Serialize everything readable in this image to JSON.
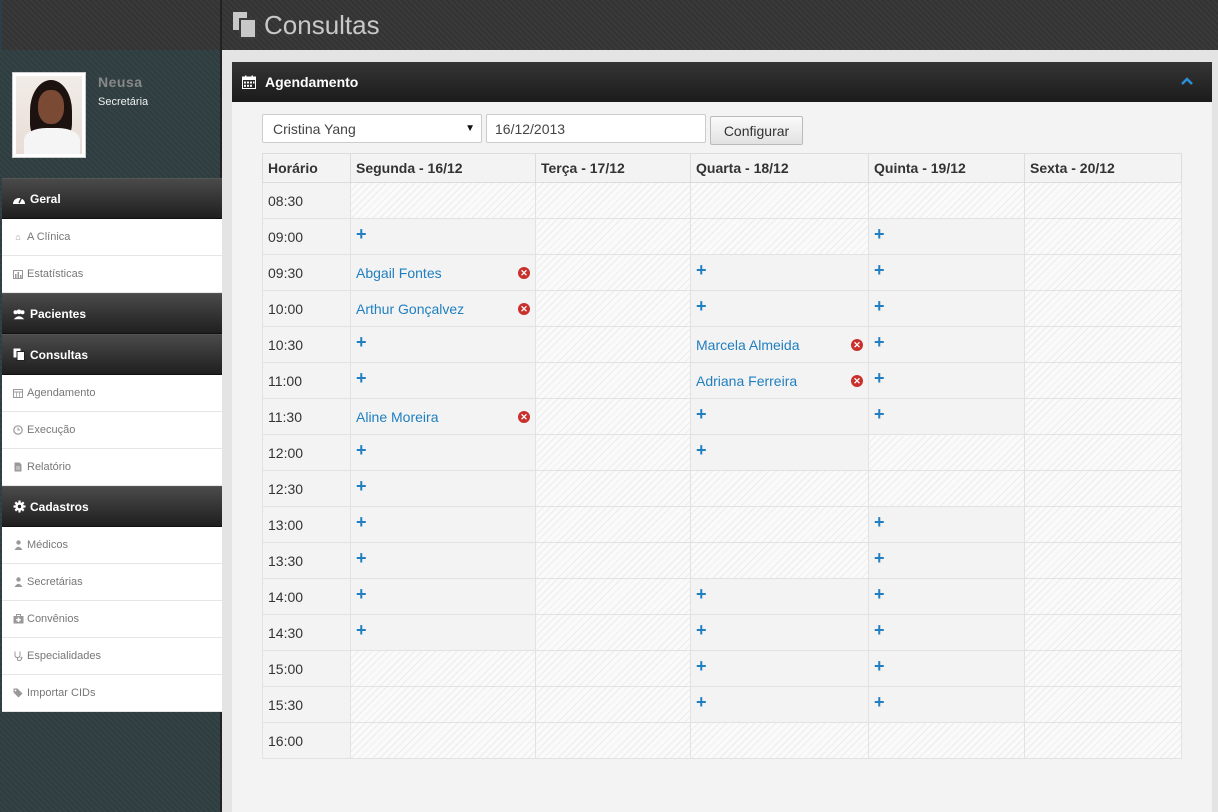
{
  "header": {
    "title": "Consultas"
  },
  "user": {
    "name": "Neusa",
    "role": "Secretária"
  },
  "sidebar": {
    "sections": [
      {
        "label": "Geral",
        "icon": "dashboard-icon",
        "items": [
          {
            "label": "A Clínica",
            "icon": "home-icon"
          },
          {
            "label": "Estatísticas",
            "icon": "bar-chart-icon"
          }
        ]
      },
      {
        "label": "Pacientes",
        "icon": "users-icon",
        "items": []
      },
      {
        "label": "Consultas",
        "icon": "copy-icon",
        "items": [
          {
            "label": "Agendamento",
            "icon": "calendar-icon"
          },
          {
            "label": "Execução",
            "icon": "clock-icon"
          },
          {
            "label": "Relatório",
            "icon": "file-icon"
          }
        ]
      },
      {
        "label": "Cadastros",
        "icon": "gear-icon",
        "items": [
          {
            "label": "Médicos",
            "icon": "user-md-icon"
          },
          {
            "label": "Secretárias",
            "icon": "user-icon"
          },
          {
            "label": "Convênios",
            "icon": "medkit-icon"
          },
          {
            "label": "Especialidades",
            "icon": "stethoscope-icon"
          },
          {
            "label": "Importar CIDs",
            "icon": "tags-icon"
          }
        ]
      }
    ]
  },
  "panel": {
    "title": "Agendamento",
    "doctor_select": "Cristina Yang",
    "date_value": "16/12/2013",
    "configure_label": "Configurar"
  },
  "schedule": {
    "time_header": "Horário",
    "days": [
      "Segunda - 16/12",
      "Terça - 17/12",
      "Quarta - 18/12",
      "Quinta - 19/12",
      "Sexta - 20/12"
    ],
    "rows": [
      {
        "time": "08:30",
        "cells": [
          {
            "t": "blocked"
          },
          {
            "t": "blocked"
          },
          {
            "t": "blocked"
          },
          {
            "t": "blocked"
          },
          {
            "t": "blocked"
          }
        ]
      },
      {
        "time": "09:00",
        "cells": [
          {
            "t": "add"
          },
          {
            "t": "blocked"
          },
          {
            "t": "blocked"
          },
          {
            "t": "add"
          },
          {
            "t": "blocked"
          }
        ]
      },
      {
        "time": "09:30",
        "cells": [
          {
            "t": "appt",
            "name": "Abgail Fontes"
          },
          {
            "t": "blocked"
          },
          {
            "t": "add"
          },
          {
            "t": "add"
          },
          {
            "t": "blocked"
          }
        ]
      },
      {
        "time": "10:00",
        "cells": [
          {
            "t": "appt",
            "name": "Arthur Gonçalvez"
          },
          {
            "t": "blocked"
          },
          {
            "t": "add"
          },
          {
            "t": "add"
          },
          {
            "t": "blocked"
          }
        ]
      },
      {
        "time": "10:30",
        "cells": [
          {
            "t": "add"
          },
          {
            "t": "blocked"
          },
          {
            "t": "appt",
            "name": "Marcela Almeida"
          },
          {
            "t": "add"
          },
          {
            "t": "blocked"
          }
        ]
      },
      {
        "time": "11:00",
        "cells": [
          {
            "t": "add"
          },
          {
            "t": "blocked"
          },
          {
            "t": "appt",
            "name": "Adriana Ferreira"
          },
          {
            "t": "add"
          },
          {
            "t": "blocked"
          }
        ]
      },
      {
        "time": "11:30",
        "cells": [
          {
            "t": "appt",
            "name": "Aline Moreira"
          },
          {
            "t": "blocked"
          },
          {
            "t": "add"
          },
          {
            "t": "add"
          },
          {
            "t": "blocked"
          }
        ]
      },
      {
        "time": "12:00",
        "cells": [
          {
            "t": "add"
          },
          {
            "t": "blocked"
          },
          {
            "t": "add"
          },
          {
            "t": "blocked"
          },
          {
            "t": "blocked"
          }
        ]
      },
      {
        "time": "12:30",
        "cells": [
          {
            "t": "add"
          },
          {
            "t": "blocked"
          },
          {
            "t": "blocked"
          },
          {
            "t": "blocked"
          },
          {
            "t": "blocked"
          }
        ]
      },
      {
        "time": "13:00",
        "cells": [
          {
            "t": "add"
          },
          {
            "t": "blocked"
          },
          {
            "t": "blocked"
          },
          {
            "t": "add"
          },
          {
            "t": "blocked"
          }
        ]
      },
      {
        "time": "13:30",
        "cells": [
          {
            "t": "add"
          },
          {
            "t": "blocked"
          },
          {
            "t": "blocked"
          },
          {
            "t": "add"
          },
          {
            "t": "blocked"
          }
        ]
      },
      {
        "time": "14:00",
        "cells": [
          {
            "t": "add"
          },
          {
            "t": "blocked"
          },
          {
            "t": "add"
          },
          {
            "t": "add"
          },
          {
            "t": "blocked"
          }
        ]
      },
      {
        "time": "14:30",
        "cells": [
          {
            "t": "add"
          },
          {
            "t": "blocked"
          },
          {
            "t": "add"
          },
          {
            "t": "add"
          },
          {
            "t": "blocked"
          }
        ]
      },
      {
        "time": "15:00",
        "cells": [
          {
            "t": "blocked"
          },
          {
            "t": "blocked"
          },
          {
            "t": "add"
          },
          {
            "t": "add"
          },
          {
            "t": "blocked"
          }
        ]
      },
      {
        "time": "15:30",
        "cells": [
          {
            "t": "blocked"
          },
          {
            "t": "blocked"
          },
          {
            "t": "add"
          },
          {
            "t": "add"
          },
          {
            "t": "blocked"
          }
        ]
      },
      {
        "time": "16:00",
        "cells": [
          {
            "t": "blocked"
          },
          {
            "t": "blocked"
          },
          {
            "t": "blocked"
          },
          {
            "t": "blocked"
          },
          {
            "t": "blocked"
          }
        ]
      }
    ]
  },
  "colors": {
    "link": "#1f7fc0",
    "cancel": "#c9302c",
    "header_bg": "#1b1b1b"
  }
}
